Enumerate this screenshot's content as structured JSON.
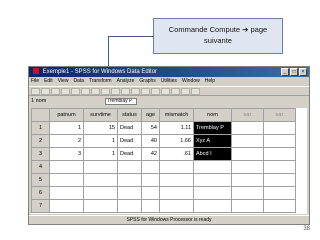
{
  "callout": {
    "text": "Commande Compute ➔ page suivante"
  },
  "window": {
    "title": "Exemple1 - SPSS for Windows Data Editor",
    "controls": [
      "_",
      "□",
      "×"
    ]
  },
  "menu": [
    "File",
    "Edit",
    "View",
    "Data",
    "Transform",
    "Analyze",
    "Graphs",
    "Utilities",
    "Window",
    "Help"
  ],
  "cellbar": {
    "ref": "1 nom",
    "value": "Tremblay P"
  },
  "grid": {
    "columns": [
      "patnum",
      "survtime",
      "status",
      "age",
      "mismatch",
      "nom",
      "var",
      "var"
    ],
    "rows": [
      {
        "n": "1",
        "cells": [
          "1",
          "15",
          "Dead",
          "54",
          "1.11",
          "Tremblay P",
          "",
          ""
        ]
      },
      {
        "n": "2",
        "cells": [
          "2",
          "1",
          "Dead",
          "40",
          "1.66",
          "Xyz A",
          "",
          ""
        ]
      },
      {
        "n": "3",
        "cells": [
          "3",
          "1",
          "Dead",
          "42",
          ".61",
          "Abcd I",
          "",
          ""
        ]
      },
      {
        "n": "4",
        "cells": [
          "",
          "",
          "",
          "",
          "",
          "",
          "",
          ""
        ]
      },
      {
        "n": "5",
        "cells": [
          "",
          "",
          "",
          "",
          "",
          "",
          "",
          ""
        ]
      },
      {
        "n": "6",
        "cells": [
          "",
          "",
          "",
          "",
          "",
          "",
          "",
          ""
        ]
      },
      {
        "n": "7",
        "cells": [
          "",
          "",
          "",
          "",
          "",
          "",
          "",
          ""
        ]
      }
    ]
  },
  "status": "SPSS for Windows Processor is ready",
  "page_number": "38"
}
